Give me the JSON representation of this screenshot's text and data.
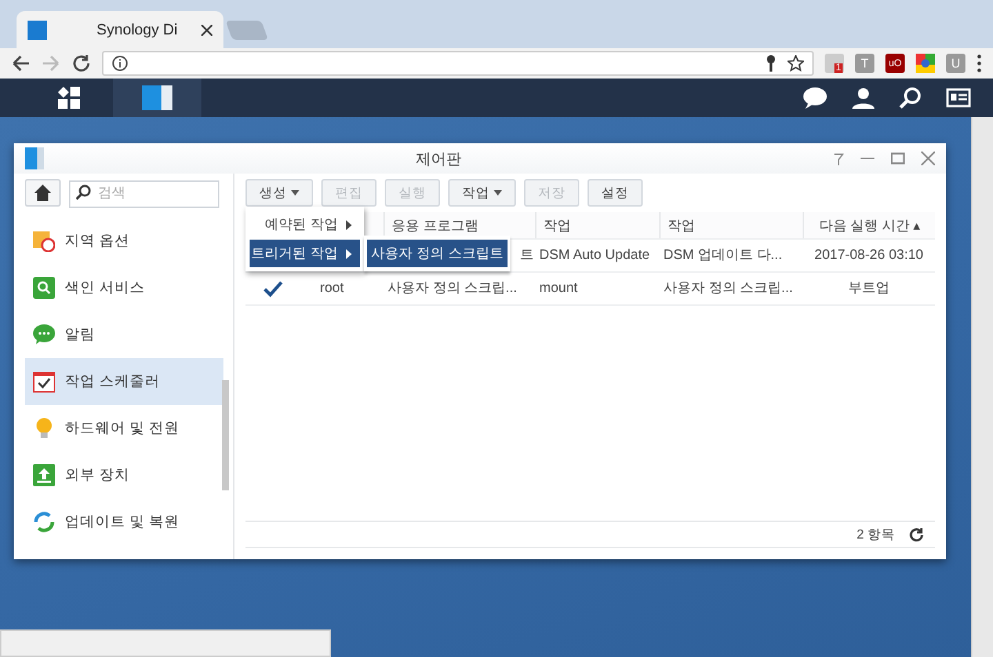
{
  "browser": {
    "tab_title": "Synology Di",
    "extensions": [
      {
        "kind": "shield",
        "label": "1"
      },
      {
        "kind": "letter",
        "label": "T"
      },
      {
        "kind": "block",
        "label": "uO"
      },
      {
        "kind": "chrome"
      },
      {
        "kind": "letter",
        "label": "U"
      }
    ]
  },
  "window": {
    "title": "제어판"
  },
  "search": {
    "placeholder": "검색"
  },
  "sidebar": {
    "items": [
      {
        "label": "지역 옵션",
        "selected": false
      },
      {
        "label": "색인 서비스",
        "selected": false
      },
      {
        "label": "알림",
        "selected": false
      },
      {
        "label": "작업 스케줄러",
        "selected": true
      },
      {
        "label": "하드웨어 및 전원",
        "selected": false
      },
      {
        "label": "외부 장치",
        "selected": false
      },
      {
        "label": "업데이트 및 복원",
        "selected": false
      }
    ]
  },
  "toolbar": [
    {
      "label": "생성",
      "dropdown": true,
      "disabled": false
    },
    {
      "label": "편집",
      "dropdown": false,
      "disabled": true
    },
    {
      "label": "실행",
      "dropdown": false,
      "disabled": true
    },
    {
      "label": "작업",
      "dropdown": true,
      "disabled": false
    },
    {
      "label": "저장",
      "dropdown": false,
      "disabled": true
    },
    {
      "label": "설정",
      "dropdown": false,
      "disabled": false
    }
  ],
  "table": {
    "columns": [
      "응용 프로그램",
      "작업",
      "작업",
      "다음 실행 시간 ▴"
    ],
    "rows": [
      {
        "cells": [
          {
            "text": "트",
            "kind": "partial"
          },
          {
            "text": "DSM Auto Update",
            "kind": "plain"
          },
          {
            "text": "DSM 업데이트 다...",
            "kind": "plain"
          },
          {
            "text": "2017-08-26 03:10",
            "kind": "plain"
          }
        ]
      },
      {
        "checked": true,
        "user": "root",
        "cells": [
          {
            "text": "사용자 정의 스크립...",
            "kind": "plain"
          },
          {
            "text": "mount",
            "kind": "plain"
          },
          {
            "text": "사용자 정의 스크립...",
            "kind": "plain"
          },
          {
            "text": "부트업",
            "kind": "plain"
          }
        ]
      }
    ]
  },
  "menu": {
    "items": [
      {
        "label": "예약된 작업",
        "selected": false
      },
      {
        "label": "트리거된 작업",
        "selected": true
      }
    ],
    "submenu": [
      {
        "label": "사용자 정의 스크립트",
        "selected": true
      }
    ]
  },
  "footer": {
    "count": "2 항목"
  }
}
